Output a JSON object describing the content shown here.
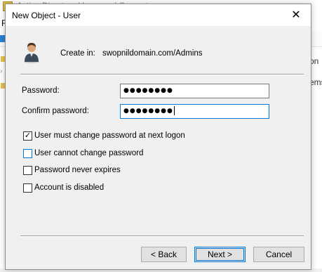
{
  "background_app": {
    "title": "Active Directory Users and Computers",
    "menu_first_letter": "F",
    "right_col_text1": "on",
    "right_col_text2": "ems"
  },
  "dialog": {
    "title": "New Object - User",
    "close_glyph": "✕",
    "create_in_label": "Create in:",
    "create_in_value": "swopnildomain.com/Admins",
    "password_label": "Password:",
    "password_value": "●●●●●●●●",
    "confirm_label": "Confirm password:",
    "confirm_value": "●●●●●●●●",
    "checkboxes": [
      {
        "label": "User must change password at next logon",
        "checked": true
      },
      {
        "label": "User cannot change password",
        "checked": false
      },
      {
        "label": "Password never expires",
        "checked": false
      },
      {
        "label": "Account is disabled",
        "checked": false
      }
    ],
    "buttons": {
      "back": "< Back",
      "next": "Next >",
      "cancel": "Cancel"
    },
    "check_glyph": "✓"
  },
  "icons": [
    "user-icon",
    "close-icon",
    "folder-icon",
    "chevron-right-icon"
  ],
  "colors": {
    "focus_accent": "#0078d7",
    "dialog_bg": "#f0f0f0"
  }
}
